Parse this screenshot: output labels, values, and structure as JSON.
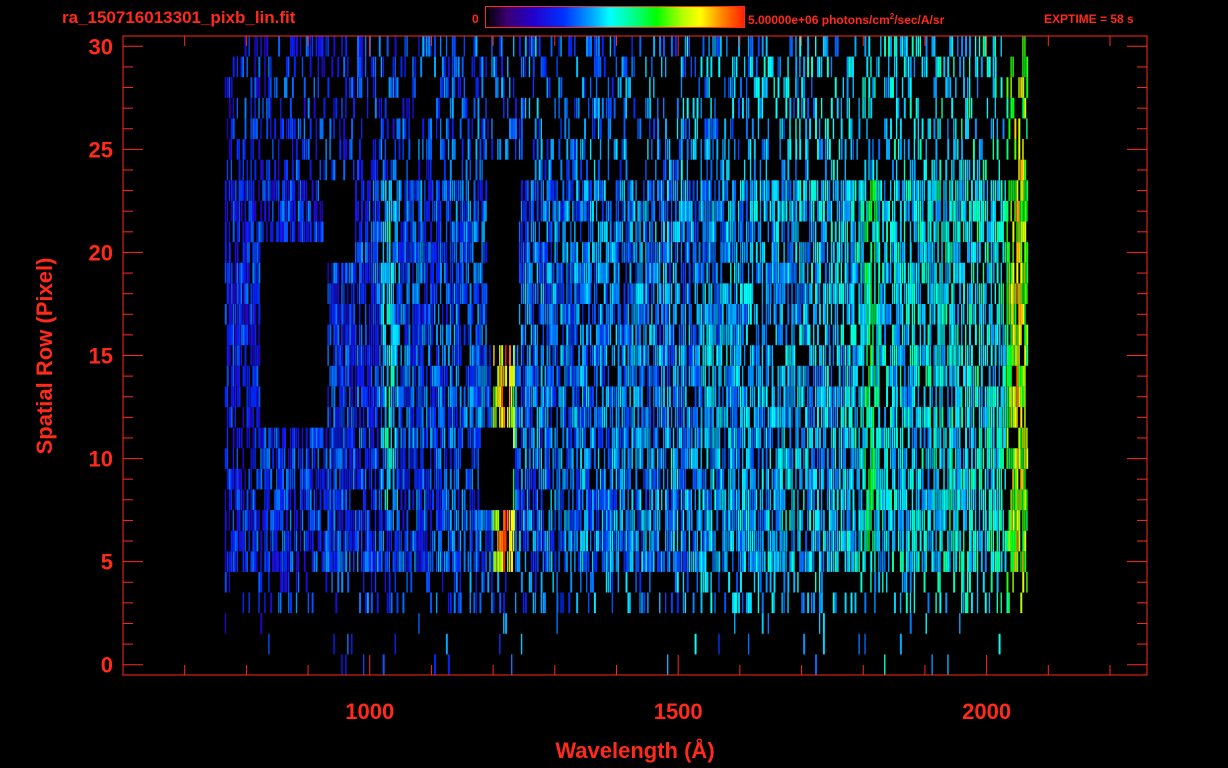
{
  "header": {
    "file_title": "ra_150716013301_pixb_lin.fit",
    "colorbar_min": "0",
    "colorbar_max_prefix": "5.00000e+06 photons/cm",
    "colorbar_max_exp": "2",
    "colorbar_max_suffix": "/sec/A/sr",
    "exptime": "EXPTIME = 58 s"
  },
  "chart_data": {
    "type": "heatmap",
    "xlabel": "Wavelength (Å)",
    "ylabel": "Spatial Row (Pixel)",
    "xlim": [
      600,
      2260
    ],
    "ylim": [
      -0.5,
      30.5
    ],
    "x_ticks": [
      1000,
      1500,
      2000
    ],
    "y_ticks": [
      0,
      5,
      10,
      15,
      20,
      25,
      30
    ],
    "colorbar": {
      "min": 0,
      "max": 5000000,
      "units": "photons/cm2/sec/A/sr",
      "colormap": "rainbow"
    },
    "data_extent": {
      "x_min": 765,
      "x_max": 2065,
      "y_min": 0,
      "y_max": 30
    },
    "features": [
      {
        "x": 1216,
        "y_range": [
          5,
          16
        ],
        "level": 0.95
      },
      {
        "x": 1030,
        "y_range": [
          8,
          23
        ],
        "level": 0.5
      },
      {
        "x": 1810,
        "y_range": [
          5,
          23
        ],
        "level": 0.62
      },
      {
        "x": 2050,
        "y_range": [
          2,
          30
        ],
        "level": 0.85
      }
    ],
    "masked_regions": [
      {
        "x": [
          820,
          930
        ],
        "y": [
          12,
          20
        ]
      },
      {
        "x": [
          925,
          975
        ],
        "y": [
          20,
          23
        ]
      },
      {
        "x": [
          1190,
          1240
        ],
        "y": [
          16,
          24
        ]
      },
      {
        "x": [
          1180,
          1230
        ],
        "y": [
          8,
          11
        ]
      }
    ]
  },
  "colors": {
    "axis": "#ff2a1a",
    "background": "#000000"
  }
}
